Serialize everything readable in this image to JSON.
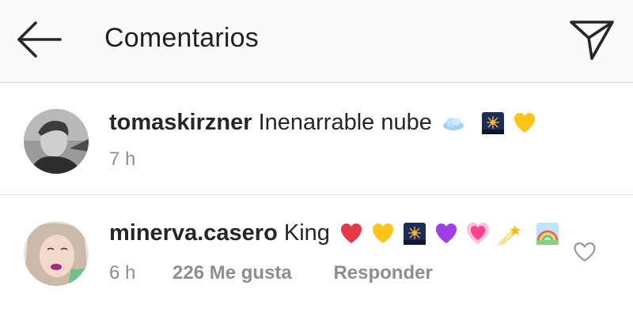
{
  "header": {
    "title": "Comentarios",
    "back_icon": "arrow-left-icon",
    "send_icon": "paper-plane-icon"
  },
  "comments": [
    {
      "username": "tomaskirzner",
      "text": "Inenarrable nube",
      "emojis": [
        "cloud",
        "night-sky",
        "yellow-heart"
      ],
      "time": "7 h"
    },
    {
      "username": "minerva.casero",
      "text": "King",
      "emojis": [
        "red-heart",
        "yellow-heart",
        "night-sky",
        "purple-heart",
        "growing-heart",
        "shooting-star",
        "rainbow-scene"
      ],
      "time": "6 h",
      "likes": "226 Me gusta",
      "reply_label": "Responder"
    }
  ]
}
